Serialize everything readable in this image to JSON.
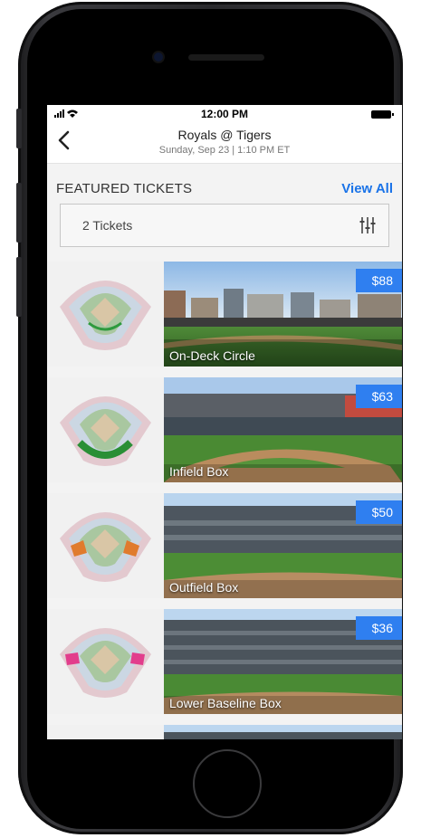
{
  "status": {
    "signal": "•••l ▾",
    "time": "12:00 PM"
  },
  "header": {
    "back_icon": "chevron-left-icon",
    "title": "Royals @ Tigers",
    "subtitle": "Sunday, Sep 23 | 1:10 PM ET"
  },
  "section": {
    "title": "FEATURED TICKETS",
    "view_all": "View All"
  },
  "selector": {
    "label": "2 Tickets",
    "filter_icon": "sliders-icon"
  },
  "tickets": [
    {
      "label": "On-Deck Circle",
      "price": "$88"
    },
    {
      "label": "Infield Box",
      "price": "$63"
    },
    {
      "label": "Outfield Box",
      "price": "$50"
    },
    {
      "label": "Lower Baseline Box",
      "price": "$36"
    }
  ],
  "colors": {
    "accent": "#2f7ff0",
    "link": "#1a73e8"
  }
}
